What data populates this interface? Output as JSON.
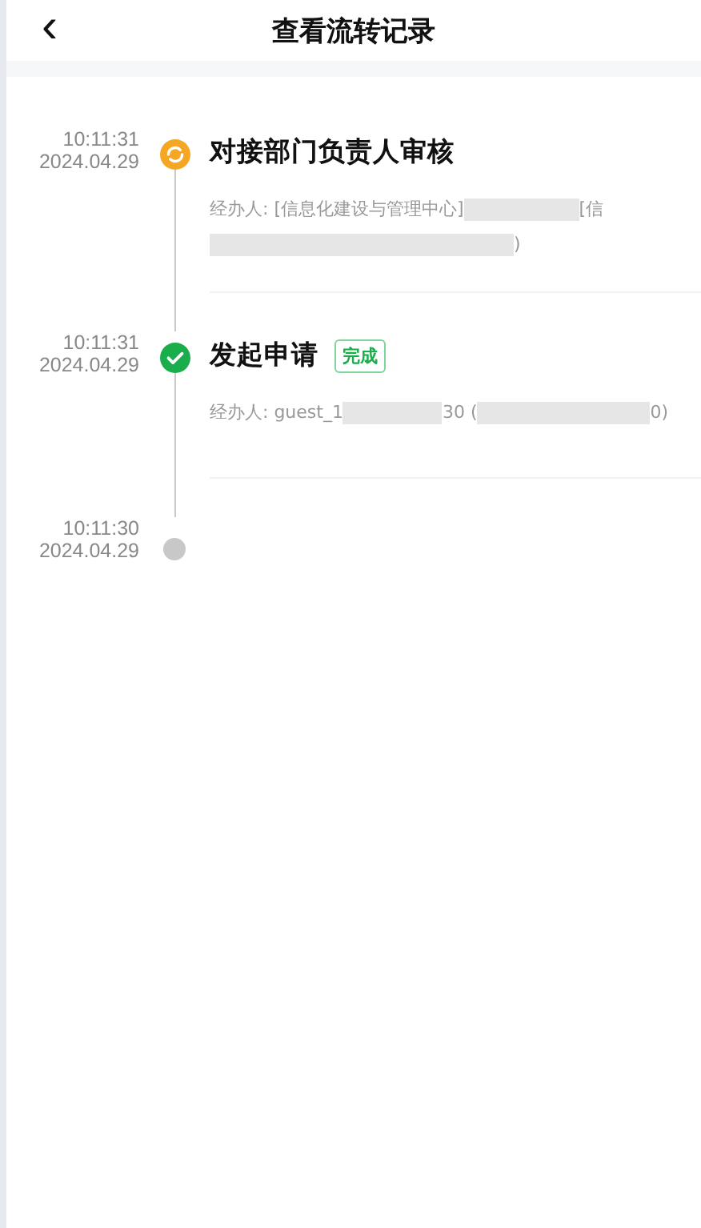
{
  "header": {
    "back": "‹",
    "title": "查看流转记录"
  },
  "steps": [
    {
      "time": "10:11:31",
      "date": "2024.04.29",
      "kind": "processing",
      "title": "对接部门负责人审核",
      "handler": [
        {
          "kind": "text",
          "text": "经办人: [信息化建设与管理中心]"
        },
        {
          "kind": "redacted"
        },
        {
          "kind": "text",
          "text": "[信"
        },
        {
          "kind": "redacted"
        },
        {
          "kind": "text",
          "text": ")"
        }
      ]
    },
    {
      "time": "10:11:31",
      "date": "2024.04.29",
      "kind": "done",
      "title": "发起申请",
      "tag": "完成",
      "handler": [
        {
          "kind": "text",
          "text": "经办人: guest_1"
        },
        {
          "kind": "redacted"
        },
        {
          "kind": "text",
          "text": "30 ("
        },
        {
          "kind": "redacted"
        },
        {
          "kind": "text",
          "text": "0)"
        }
      ]
    },
    {
      "time": "10:11:30",
      "date": "2024.04.29",
      "kind": "start"
    }
  ]
}
